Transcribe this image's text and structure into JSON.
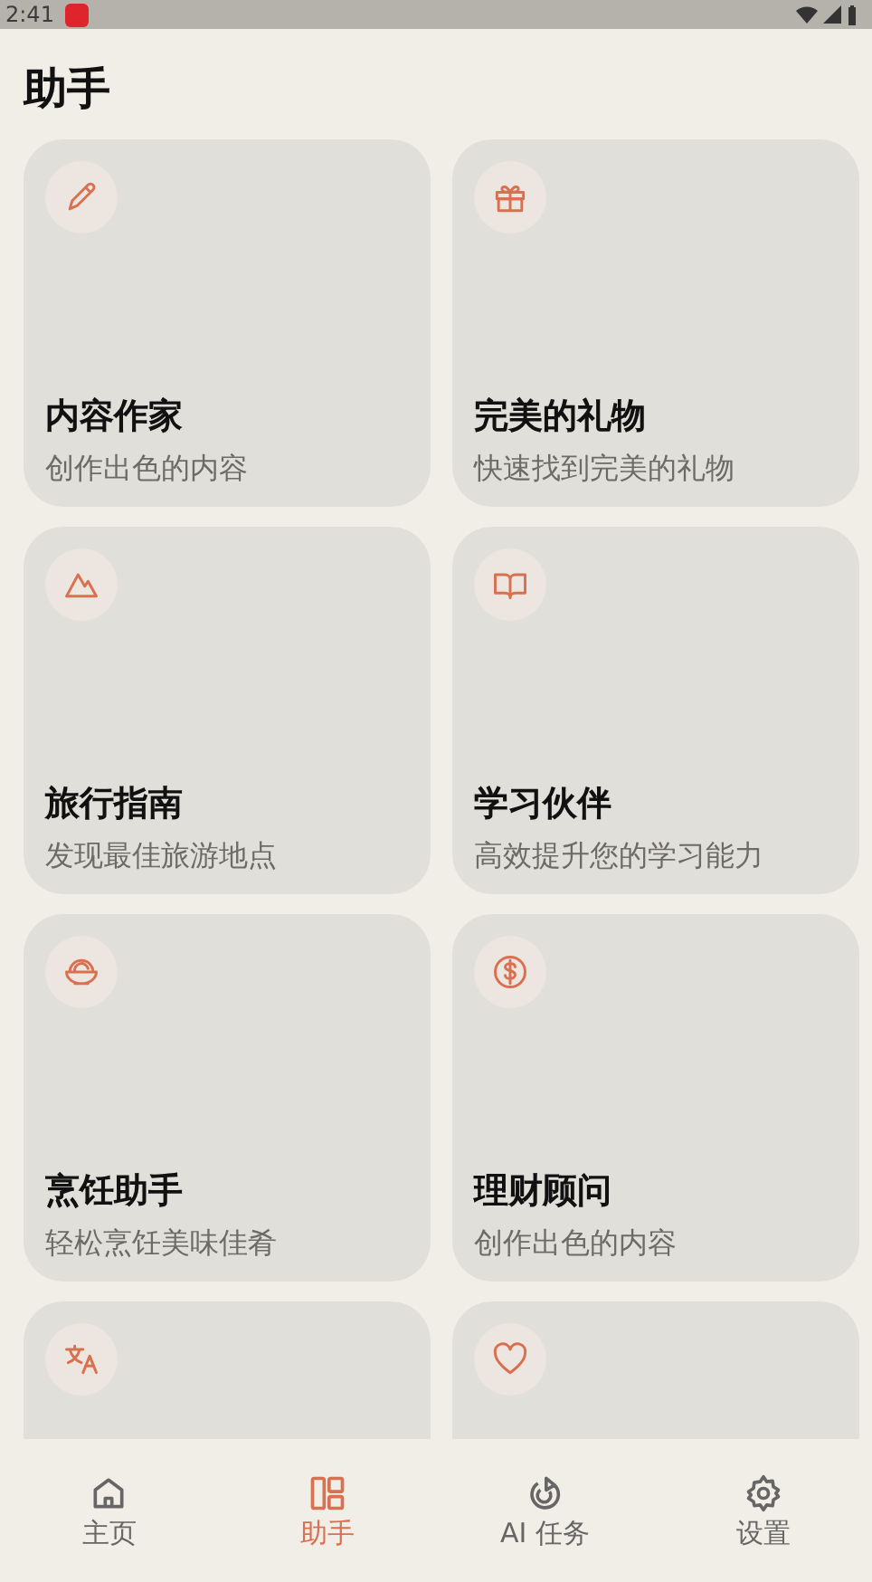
{
  "status_bar": {
    "time": "2:41"
  },
  "title": "助手",
  "cards": [
    {
      "kind": "full",
      "title": "内容作家",
      "subtitle": "创作出色的内容"
    },
    {
      "kind": "full",
      "title": "完美的礼物",
      "subtitle": "快速找到完美的礼物"
    },
    {
      "kind": "full",
      "title": "旅行指南",
      "subtitle": "发现最佳旅游地点"
    },
    {
      "kind": "full",
      "title": "学习伙伴",
      "subtitle": "高效提升您的学习能力"
    },
    {
      "kind": "full",
      "title": "烹饪助手",
      "subtitle": "轻松烹饪美味佳肴"
    },
    {
      "kind": "full",
      "title": "理财顾问",
      "subtitle": "创作出色的内容"
    },
    {
      "kind": "cut"
    },
    {
      "kind": "cut"
    }
  ],
  "nav": [
    {
      "label": "主页",
      "selected": false
    },
    {
      "label": "助手",
      "selected": true
    },
    {
      "label": "AI 任务",
      "selected": false
    },
    {
      "label": "设置",
      "selected": false
    }
  ]
}
